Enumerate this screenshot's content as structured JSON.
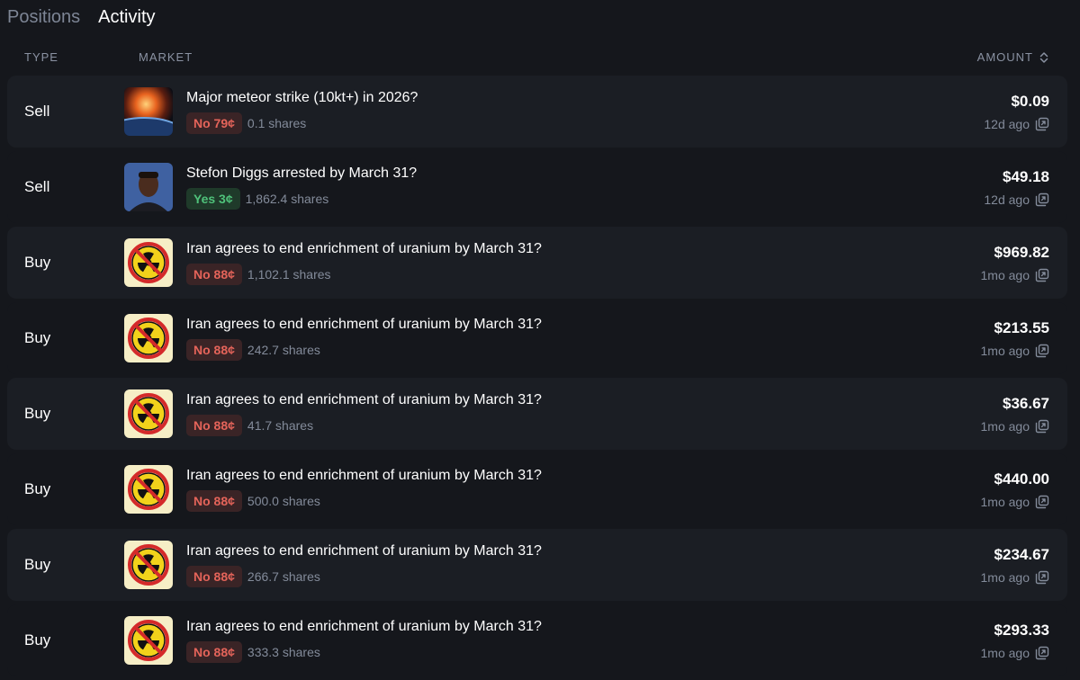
{
  "tabs": [
    {
      "label": "Positions",
      "active": false
    },
    {
      "label": "Activity",
      "active": true
    }
  ],
  "columns": {
    "type": "TYPE",
    "market": "MARKET",
    "amount": "AMOUNT"
  },
  "colors": {
    "no": "#e5645a",
    "yes": "#4fc27a",
    "background": "#15171c",
    "row": "#1b1e24"
  },
  "rows": [
    {
      "type": "Sell",
      "title": "Major meteor strike (10kt+) in 2026?",
      "outcome": "No 79¢",
      "outcome_kind": "no",
      "shares": "0.1 shares",
      "amount": "$0.09",
      "time": "12d ago",
      "thumb": "meteor-thumbnail"
    },
    {
      "type": "Sell",
      "title": "Stefon Diggs arrested by March 31?",
      "outcome": "Yes 3¢",
      "outcome_kind": "yes",
      "shares": "1,862.4 shares",
      "amount": "$49.18",
      "time": "12d ago",
      "thumb": "person-thumbnail"
    },
    {
      "type": "Buy",
      "title": "Iran agrees to end enrichment of uranium by March 31?",
      "outcome": "No 88¢",
      "outcome_kind": "no",
      "shares": "1,102.1 shares",
      "amount": "$969.82",
      "time": "1mo ago",
      "thumb": "no-nuclear-thumbnail"
    },
    {
      "type": "Buy",
      "title": "Iran agrees to end enrichment of uranium by March 31?",
      "outcome": "No 88¢",
      "outcome_kind": "no",
      "shares": "242.7 shares",
      "amount": "$213.55",
      "time": "1mo ago",
      "thumb": "no-nuclear-thumbnail"
    },
    {
      "type": "Buy",
      "title": "Iran agrees to end enrichment of uranium by March 31?",
      "outcome": "No 88¢",
      "outcome_kind": "no",
      "shares": "41.7 shares",
      "amount": "$36.67",
      "time": "1mo ago",
      "thumb": "no-nuclear-thumbnail"
    },
    {
      "type": "Buy",
      "title": "Iran agrees to end enrichment of uranium by March 31?",
      "outcome": "No 88¢",
      "outcome_kind": "no",
      "shares": "500.0 shares",
      "amount": "$440.00",
      "time": "1mo ago",
      "thumb": "no-nuclear-thumbnail"
    },
    {
      "type": "Buy",
      "title": "Iran agrees to end enrichment of uranium by March 31?",
      "outcome": "No 88¢",
      "outcome_kind": "no",
      "shares": "266.7 shares",
      "amount": "$234.67",
      "time": "1mo ago",
      "thumb": "no-nuclear-thumbnail"
    },
    {
      "type": "Buy",
      "title": "Iran agrees to end enrichment of uranium by March 31?",
      "outcome": "No 88¢",
      "outcome_kind": "no",
      "shares": "333.3 shares",
      "amount": "$293.33",
      "time": "1mo ago",
      "thumb": "no-nuclear-thumbnail"
    }
  ]
}
